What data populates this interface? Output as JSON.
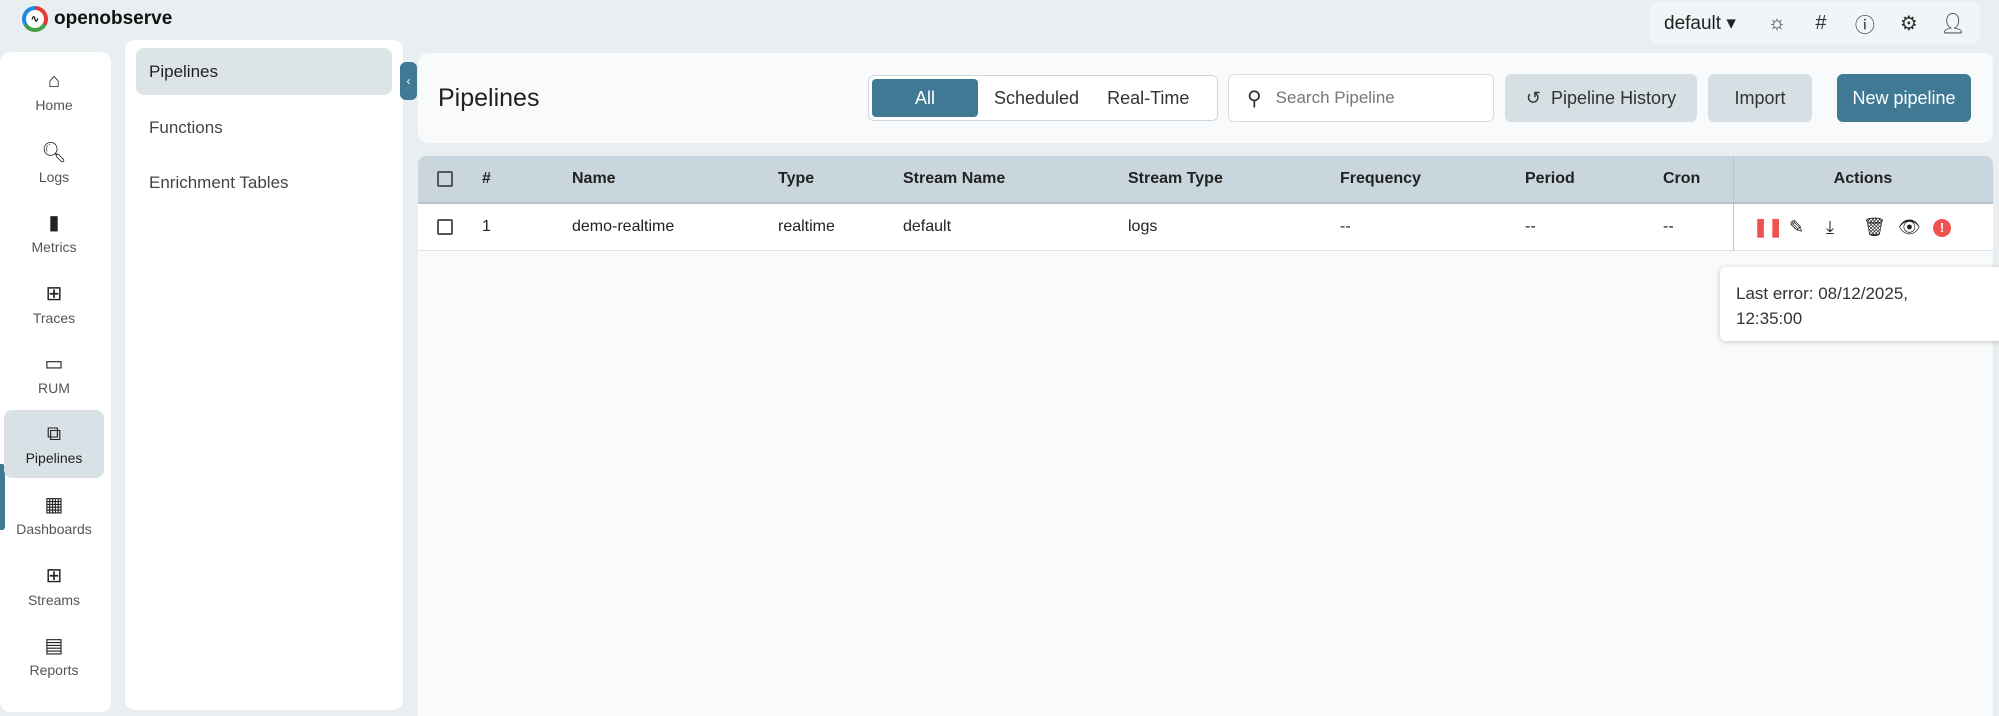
{
  "app": {
    "logo_text": "openobserve"
  },
  "topbar": {
    "org": "default",
    "icons": [
      "theme-icon",
      "slack-icon",
      "help-icon",
      "settings-icon",
      "user-icon"
    ]
  },
  "rail": [
    {
      "label": "Home",
      "icon": "⌂"
    },
    {
      "label": "Logs",
      "icon": "🔍︎"
    },
    {
      "label": "Metrics",
      "icon": "▮"
    },
    {
      "label": "Traces",
      "icon": "⊞"
    },
    {
      "label": "RUM",
      "icon": "▭"
    },
    {
      "label": "Pipelines",
      "icon": "⧉"
    },
    {
      "label": "Dashboards",
      "icon": "▦"
    },
    {
      "label": "Streams",
      "icon": "⊞"
    },
    {
      "label": "Reports",
      "icon": "▤"
    }
  ],
  "submenu": [
    "Pipelines",
    "Functions",
    "Enrichment Tables"
  ],
  "header": {
    "title": "Pipelines",
    "tabs": [
      "All",
      "Scheduled",
      "Real-Time"
    ],
    "search_placeholder": "Search Pipeline",
    "history": "Pipeline History",
    "import": "Import",
    "new": "New pipeline"
  },
  "table": {
    "columns": [
      "#",
      "Name",
      "Type",
      "Stream Name",
      "Stream Type",
      "Frequency",
      "Period",
      "Cron",
      "Actions"
    ],
    "rows": [
      {
        "num": "1",
        "name": "demo-realtime",
        "type": "realtime",
        "stream_name": "default",
        "stream_type": "logs",
        "frequency": "--",
        "period": "--",
        "cron": "--"
      }
    ]
  },
  "tooltip": {
    "line1": "Last error: 08/12/2025,",
    "line2": "12:35:00"
  },
  "colors": {
    "accent": "#3f7994",
    "error": "#ef5350"
  }
}
